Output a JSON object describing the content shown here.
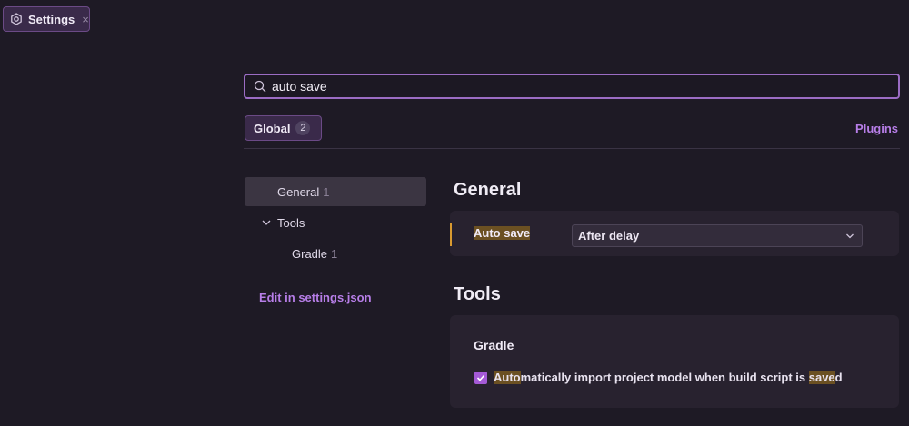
{
  "tab": {
    "label": "Settings",
    "close_glyph": "×",
    "icon": "gear-icon"
  },
  "search": {
    "value": "auto save",
    "icon": "search-icon"
  },
  "scope": {
    "label": "Global",
    "count": "2",
    "plugins_label": "Plugins"
  },
  "sidebar": {
    "items": [
      {
        "label": "General",
        "count": "1",
        "selected": true
      },
      {
        "label": "Tools",
        "expanded": true
      },
      {
        "label": "Gradle",
        "count": "1"
      }
    ],
    "edit_link": "Edit in settings.json"
  },
  "sections": {
    "general": {
      "title": "General",
      "setting_label": "Auto save",
      "select_value": "After delay"
    },
    "tools": {
      "title": "Tools",
      "group_title": "Gradle",
      "checkbox": {
        "checked": true,
        "label_parts": [
          "Auto",
          "matically import project model when build script is ",
          "save",
          "d"
        ]
      }
    }
  },
  "colors": {
    "accent": "#b77ee8",
    "highlight": "#6b5022",
    "modified_bar": "#d99a30"
  }
}
